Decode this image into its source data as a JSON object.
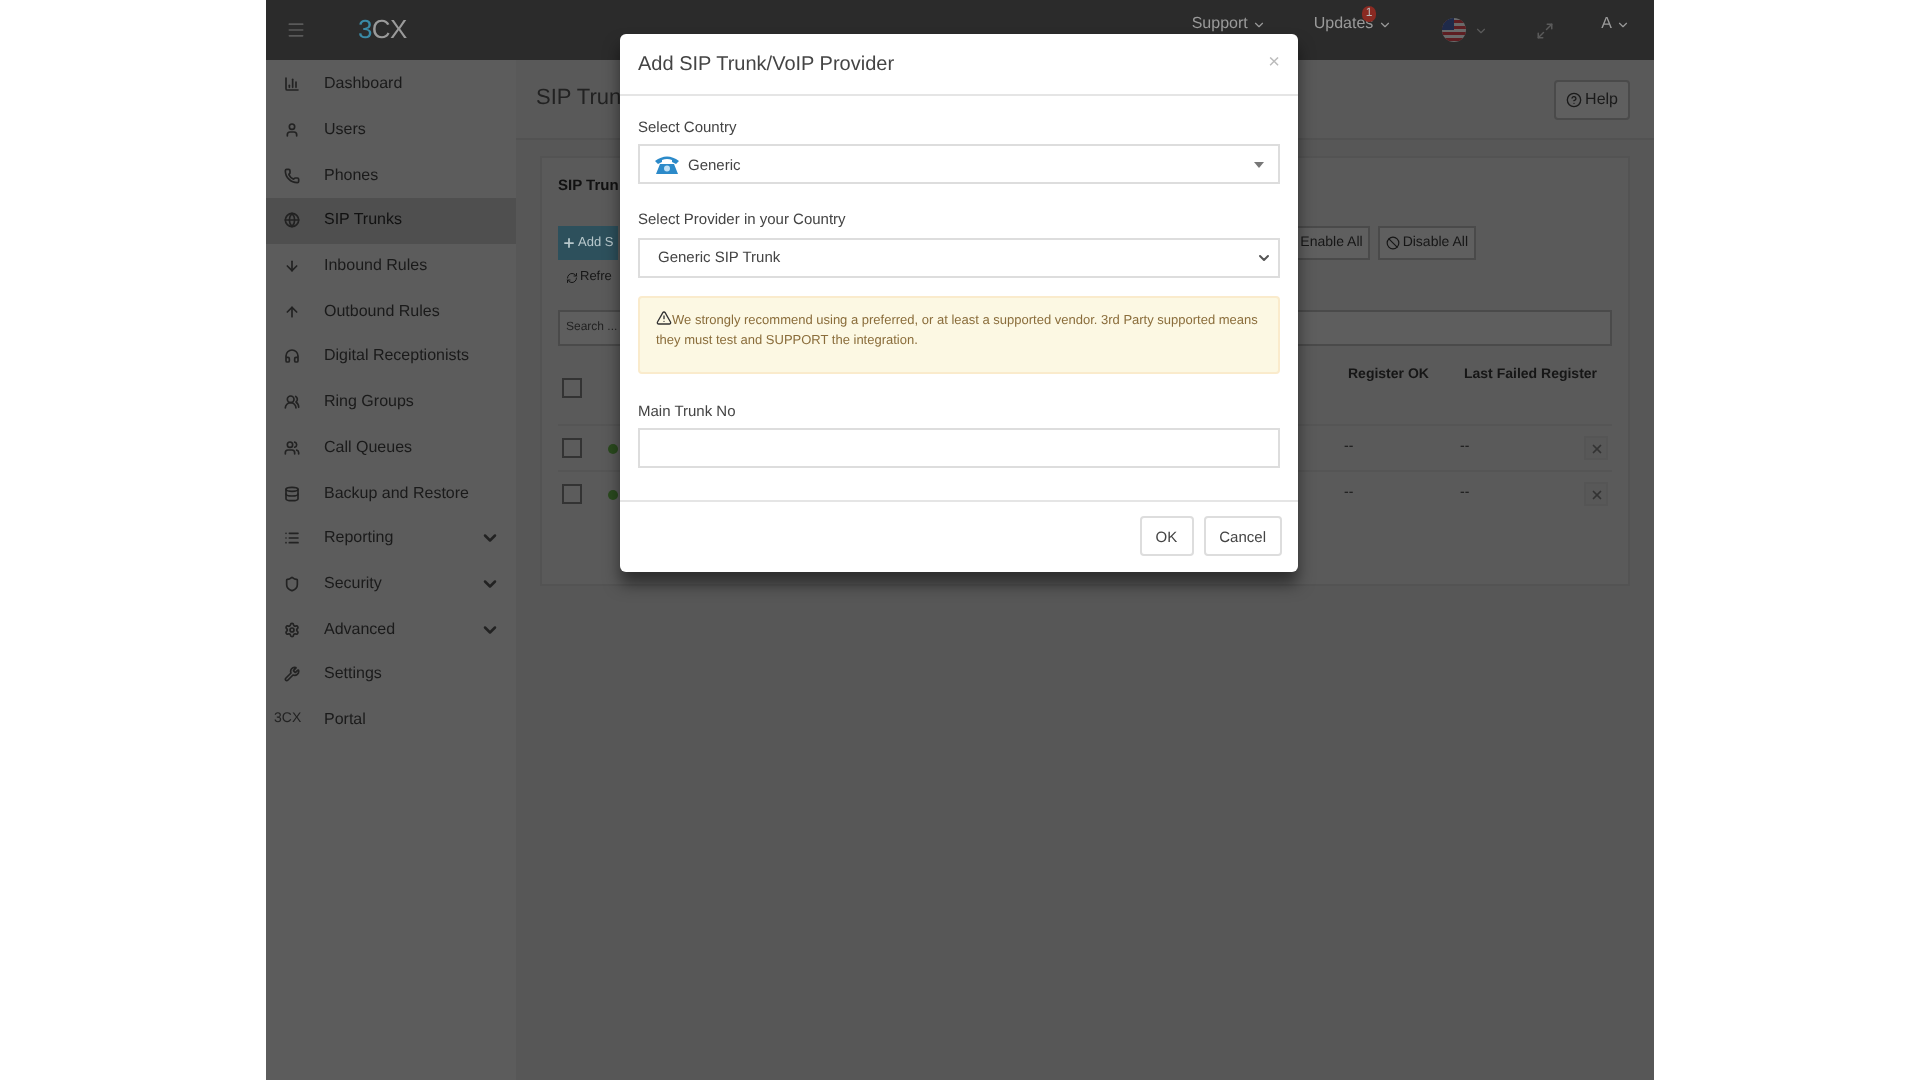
{
  "topbar": {
    "logo": [
      "3",
      "CX"
    ],
    "menus": [
      {
        "label": "Support",
        "kind": "text"
      },
      {
        "label": "Updates",
        "kind": "text",
        "badge": "1"
      },
      {
        "kind": "flag"
      },
      {
        "kind": "expand"
      },
      {
        "label": "A",
        "kind": "text"
      }
    ]
  },
  "sidebar": {
    "items": [
      {
        "label": "Dashboard",
        "kind": "chart",
        "selected": false,
        "has_submenu": false
      },
      {
        "label": "Users",
        "kind": "user",
        "selected": false,
        "has_submenu": false
      },
      {
        "label": "Phones",
        "kind": "phone",
        "selected": false,
        "has_submenu": false
      },
      {
        "label": "SIP Trunks",
        "kind": "globe",
        "selected": true,
        "has_submenu": false
      },
      {
        "label": "Inbound Rules",
        "kind": "down",
        "selected": false,
        "has_submenu": false
      },
      {
        "label": "Outbound Rules",
        "kind": "up",
        "selected": false,
        "has_submenu": false
      },
      {
        "label": "Digital Receptionists",
        "kind": "headset",
        "selected": false,
        "has_submenu": false
      },
      {
        "label": "Ring Groups",
        "kind": "group",
        "selected": false,
        "has_submenu": false
      },
      {
        "label": "Call Queues",
        "kind": "queue",
        "selected": false,
        "has_submenu": false
      },
      {
        "label": "Backup and Restore",
        "kind": "database",
        "selected": false,
        "has_submenu": false
      },
      {
        "label": "Reporting",
        "kind": "list",
        "selected": false,
        "has_submenu": true
      },
      {
        "label": "Security",
        "kind": "shield",
        "selected": false,
        "has_submenu": true
      },
      {
        "label": "Advanced",
        "kind": "gear",
        "selected": false,
        "has_submenu": true
      },
      {
        "label": "Settings",
        "kind": "wrench",
        "selected": false,
        "has_submenu": false
      },
      {
        "label": "Portal",
        "kind": "text",
        "icon_text": "3CX",
        "selected": false,
        "has_submenu": false
      }
    ]
  },
  "page": {
    "title": "SIP Trun",
    "help": "Help",
    "panel_title": "SIP Trun",
    "add_button": "Add S",
    "refresh_button": "Refre",
    "enable_all": "Enable All",
    "disable_all": "Disable All",
    "search": {
      "placeholder": "Search ..."
    },
    "table": {
      "select_all_checked": false,
      "columns": [
        "Register OK",
        "Last Failed Register"
      ],
      "rows": [
        {
          "checked": false,
          "register_ok": "--",
          "last_failed": "--"
        },
        {
          "checked": false,
          "register_ok": "--",
          "last_failed": "--"
        }
      ]
    }
  },
  "dialog": {
    "title": "Add SIP Trunk/VoIP Provider",
    "close": "×",
    "country_label": "Select Country",
    "country_value": "Generic",
    "provider_label": "Select Provider in your Country",
    "provider_value": "Generic SIP Trunk",
    "warning": "We strongly recommend using a preferred, or at least a supported vendor. 3rd Party supported means they must test and SUPPORT the integration.",
    "trunk_label": "Main Trunk No",
    "buttons": [
      "OK",
      "Cancel"
    ]
  }
}
